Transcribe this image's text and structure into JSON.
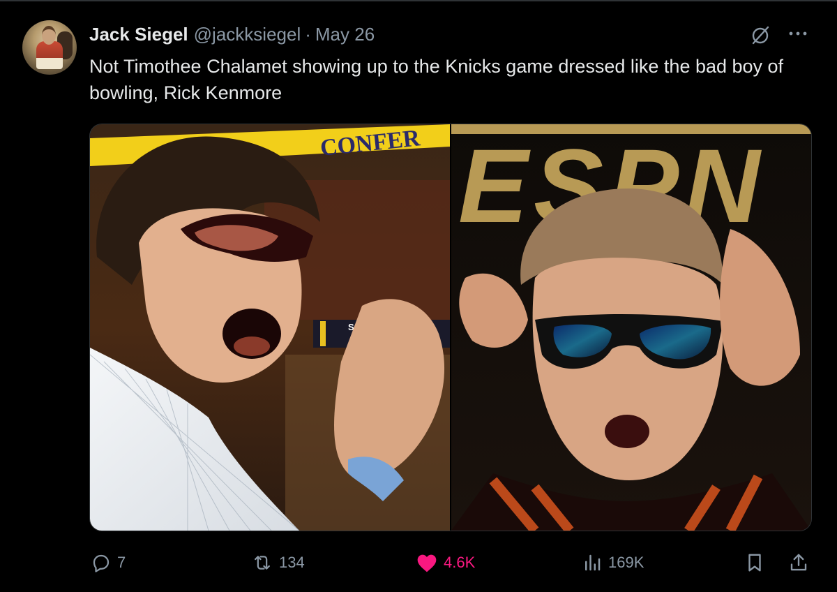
{
  "tweet": {
    "author_name": "Jack Siegel",
    "author_handle": "@jackksiegel",
    "separator": "·",
    "date": "May 26",
    "text": "Not Timothee Chalamet showing up to the Knicks game dressed like the bad boy of bowling, Rick Kenmore",
    "media": {
      "left_banner_text": "CONFER",
      "left_board_text": "SOUTH CE",
      "right_banner_text": "ESPN"
    },
    "actions": {
      "replies": "7",
      "reposts": "134",
      "likes": "4.6K",
      "views": "169K"
    }
  },
  "colors": {
    "background": "#000000",
    "text_primary": "#e7e9ea",
    "text_secondary": "#8b98a5",
    "like_pink": "#f91880"
  },
  "icons": {
    "grok": "grok-icon",
    "more": "more-icon",
    "reply": "reply-icon",
    "repost": "repost-icon",
    "like": "heart-icon",
    "views": "views-icon",
    "bookmark": "bookmark-icon",
    "share": "share-icon"
  }
}
